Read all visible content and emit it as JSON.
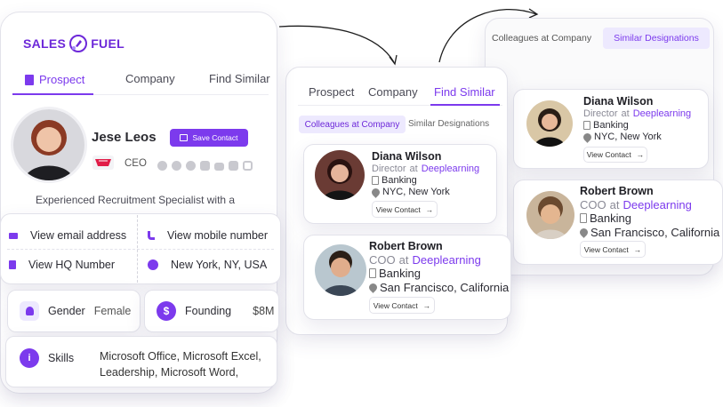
{
  "brand": {
    "name_left": "SALES",
    "name_right": "FUEL",
    "brand_color": "#6d28d9",
    "accent": "#7c3aed"
  },
  "main_card": {
    "tabs": [
      "Prospect",
      "Company",
      "Find Similar"
    ],
    "name": "Jese Leos",
    "save_label": "Save Contact",
    "title": "CEO",
    "social_icons": [
      "facebook-icon",
      "google-icon",
      "skype-icon",
      "twitter-icon",
      "youtube-icon",
      "github-icon",
      "instagram-icon"
    ],
    "bio": "Experienced Recruitment Specialist with a",
    "email_label": "View email address",
    "mobile_label": "View mobile number",
    "hq_label": "View HQ Number",
    "location": "New York, NY, USA",
    "gender_label": "Gender",
    "gender_value": "Female",
    "founding_label": "Founding",
    "founding_value": "$8M",
    "skills_label": "Skills",
    "skills_line1": "Microsoft Office, Microsoft Excel,",
    "skills_line2": "Leadership, Microsoft Word,"
  },
  "mid_card": {
    "tabs": [
      "Prospect",
      "Company",
      "Find Similar"
    ],
    "subtabs": [
      "Colleagues at Company",
      "Similar Designations"
    ],
    "people": [
      {
        "name": "Diana Wilson",
        "role": "Director",
        "at": "at",
        "company": "Deeplearning",
        "industry": "Banking",
        "location": "NYC, New York",
        "button": "View Contact"
      },
      {
        "name": "Robert Brown",
        "role": "COO",
        "at": "at",
        "company": "Deeplearning",
        "industry": "Banking",
        "location": "San Francisco, California",
        "button": "View Contact"
      }
    ]
  },
  "right_card": {
    "subtabs": [
      "Colleagues at Company",
      "Similar Designations"
    ],
    "people": [
      {
        "name": "Diana Wilson",
        "role": "Director",
        "at": "at",
        "company": "Deeplearning",
        "industry": "Banking",
        "location": "NYC, New York",
        "button": "View Contact"
      },
      {
        "name": "Robert Brown",
        "role": "COO",
        "at": "at",
        "company": "Deeplearning",
        "industry": "Banking",
        "location": "San Francisco, California",
        "button": "View Contact"
      }
    ]
  }
}
